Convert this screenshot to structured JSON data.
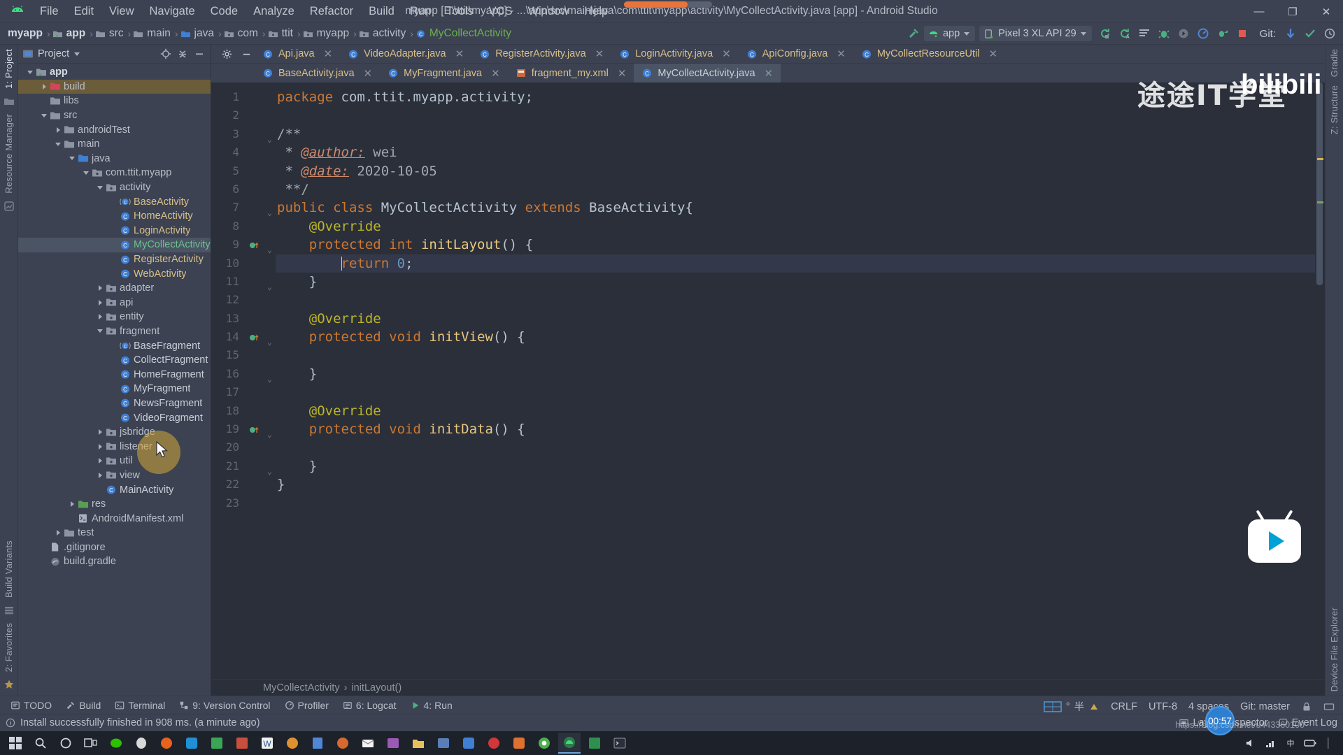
{
  "window": {
    "title": "myapp [E:\\ttit\\myapp] - ...\\app\\src\\main\\java\\com\\ttit\\myapp\\activity\\MyCollectActivity.java [app] - Android Studio",
    "minimize_label": "—",
    "maximize_label": "❐",
    "close_label": "✕"
  },
  "menu": [
    {
      "label": "File"
    },
    {
      "label": "Edit"
    },
    {
      "label": "View"
    },
    {
      "label": "Navigate"
    },
    {
      "label": "Code"
    },
    {
      "label": "Analyze"
    },
    {
      "label": "Refactor"
    },
    {
      "label": "Build"
    },
    {
      "label": "Run"
    },
    {
      "label": "Tools"
    },
    {
      "label": "VCS"
    },
    {
      "label": "Window"
    },
    {
      "label": "Help"
    }
  ],
  "breadcrumbs": [
    {
      "label": "myapp",
      "kind": "project"
    },
    {
      "label": "app",
      "kind": "module"
    },
    {
      "label": "src",
      "kind": "folder"
    },
    {
      "label": "main",
      "kind": "folder"
    },
    {
      "label": "java",
      "kind": "source-folder"
    },
    {
      "label": "com",
      "kind": "package"
    },
    {
      "label": "ttit",
      "kind": "package"
    },
    {
      "label": "myapp",
      "kind": "package"
    },
    {
      "label": "activity",
      "kind": "package"
    },
    {
      "label": "MyCollectActivity",
      "kind": "class"
    }
  ],
  "toolbar": {
    "module_selector": "app",
    "device_selector": "Pixel 3 XL API 29",
    "git_label": "Git:",
    "icons": [
      {
        "name": "sync-project-icon"
      },
      {
        "name": "avd-manager-icon"
      },
      {
        "name": "sdk-manager-icon"
      },
      {
        "name": "run-icon"
      },
      {
        "name": "debug-icon"
      },
      {
        "name": "run-coverage-icon"
      },
      {
        "name": "profiler-icon"
      },
      {
        "name": "attach-debugger-icon"
      },
      {
        "name": "stop-icon"
      },
      {
        "name": "update-project-icon"
      },
      {
        "name": "commit-icon"
      },
      {
        "name": "history-icon"
      }
    ]
  },
  "left_strip": [
    {
      "label": "1: Project",
      "active": true
    },
    {
      "label": "Resource Manager",
      "active": false
    },
    {
      "label": "Build Variants",
      "active": false
    },
    {
      "label": "2: Favorites",
      "active": false
    }
  ],
  "right_strip": [
    {
      "label": "Gradle"
    },
    {
      "label": "Z: Structure"
    },
    {
      "label": "Device File Explorer"
    }
  ],
  "project_panel": {
    "title": "Project",
    "tree": [
      {
        "depth": 0,
        "label": "app",
        "toggle": "open",
        "icon": "module-icon",
        "style": "bold"
      },
      {
        "depth": 1,
        "label": "build",
        "toggle": "closed",
        "icon": "folder-red-icon",
        "style": "plain",
        "selected_secondary": true
      },
      {
        "depth": 1,
        "label": "libs",
        "toggle": "none",
        "icon": "folder-icon",
        "style": "plain"
      },
      {
        "depth": 1,
        "label": "src",
        "toggle": "open",
        "icon": "folder-icon",
        "style": "plain"
      },
      {
        "depth": 2,
        "label": "androidTest",
        "toggle": "closed",
        "icon": "folder-icon",
        "style": "plain"
      },
      {
        "depth": 2,
        "label": "main",
        "toggle": "open",
        "icon": "folder-icon",
        "style": "plain"
      },
      {
        "depth": 3,
        "label": "java",
        "toggle": "open",
        "icon": "folder-blue-icon",
        "style": "plain"
      },
      {
        "depth": 4,
        "label": "com.ttit.myapp",
        "toggle": "open",
        "icon": "package-icon",
        "style": "plain"
      },
      {
        "depth": 5,
        "label": "activity",
        "toggle": "open",
        "icon": "package-icon",
        "style": "plain"
      },
      {
        "depth": 6,
        "label": "BaseActivity",
        "toggle": "none",
        "icon": "class-abstract-icon",
        "style": "java"
      },
      {
        "depth": 6,
        "label": "HomeActivity",
        "toggle": "none",
        "icon": "class-icon",
        "style": "java"
      },
      {
        "depth": 6,
        "label": "LoginActivity",
        "toggle": "none",
        "icon": "class-icon",
        "style": "java"
      },
      {
        "depth": 6,
        "label": "MyCollectActivity",
        "toggle": "none",
        "icon": "class-icon",
        "style": "green",
        "selected": true
      },
      {
        "depth": 6,
        "label": "RegisterActivity",
        "toggle": "none",
        "icon": "class-icon",
        "style": "java"
      },
      {
        "depth": 6,
        "label": "WebActivity",
        "toggle": "none",
        "icon": "class-icon",
        "style": "java"
      },
      {
        "depth": 5,
        "label": "adapter",
        "toggle": "closed",
        "icon": "package-icon",
        "style": "plain"
      },
      {
        "depth": 5,
        "label": "api",
        "toggle": "closed",
        "icon": "package-icon",
        "style": "plain"
      },
      {
        "depth": 5,
        "label": "entity",
        "toggle": "closed",
        "icon": "package-icon",
        "style": "plain"
      },
      {
        "depth": 5,
        "label": "fragment",
        "toggle": "open",
        "icon": "package-icon",
        "style": "plain"
      },
      {
        "depth": 6,
        "label": "BaseFragment",
        "toggle": "none",
        "icon": "class-abstract-icon",
        "style": "white"
      },
      {
        "depth": 6,
        "label": "CollectFragment",
        "toggle": "none",
        "icon": "class-icon",
        "style": "white"
      },
      {
        "depth": 6,
        "label": "HomeFragment",
        "toggle": "none",
        "icon": "class-icon",
        "style": "white"
      },
      {
        "depth": 6,
        "label": "MyFragment",
        "toggle": "none",
        "icon": "class-icon",
        "style": "white"
      },
      {
        "depth": 6,
        "label": "NewsFragment",
        "toggle": "none",
        "icon": "class-icon",
        "style": "white"
      },
      {
        "depth": 6,
        "label": "VideoFragment",
        "toggle": "none",
        "icon": "class-icon",
        "style": "white"
      },
      {
        "depth": 5,
        "label": "jsbridge",
        "toggle": "closed",
        "icon": "package-icon",
        "style": "plain"
      },
      {
        "depth": 5,
        "label": "listener",
        "toggle": "closed",
        "icon": "package-icon",
        "style": "plain"
      },
      {
        "depth": 5,
        "label": "util",
        "toggle": "closed",
        "icon": "package-icon",
        "style": "plain"
      },
      {
        "depth": 5,
        "label": "view",
        "toggle": "closed",
        "icon": "package-icon",
        "style": "plain"
      },
      {
        "depth": 5,
        "label": "MainActivity",
        "toggle": "none",
        "icon": "class-icon",
        "style": "white"
      },
      {
        "depth": 3,
        "label": "res",
        "toggle": "closed",
        "icon": "folder-green-icon",
        "style": "plain"
      },
      {
        "depth": 3,
        "label": "AndroidManifest.xml",
        "toggle": "none",
        "icon": "manifest-icon",
        "style": "plain"
      },
      {
        "depth": 2,
        "label": "test",
        "toggle": "closed",
        "icon": "folder-icon",
        "style": "plain"
      },
      {
        "depth": 1,
        "label": ".gitignore",
        "toggle": "none",
        "icon": "file-icon",
        "style": "plain"
      },
      {
        "depth": 1,
        "label": "build.gradle",
        "toggle": "none",
        "icon": "gradle-icon",
        "style": "plain"
      }
    ]
  },
  "editor": {
    "tabs_row1": [
      {
        "label": "Api.java",
        "icon": "class-icon",
        "active": false,
        "closable": true
      },
      {
        "label": "VideoAdapter.java",
        "icon": "class-icon",
        "active": false,
        "closable": true
      },
      {
        "label": "RegisterActivity.java",
        "icon": "class-icon",
        "active": false,
        "closable": true
      },
      {
        "label": "LoginActivity.java",
        "icon": "class-icon",
        "active": false,
        "closable": true
      },
      {
        "label": "ApiConfig.java",
        "icon": "class-icon",
        "active": false,
        "closable": true
      },
      {
        "label": "MyCollectResourceUtil",
        "icon": "class-icon",
        "active": false,
        "closable": true
      }
    ],
    "tabs_row2": [
      {
        "label": "BaseActivity.java",
        "icon": "class-icon",
        "active": false,
        "closable": true
      },
      {
        "label": "MyFragment.java",
        "icon": "class-icon",
        "active": false,
        "closable": true
      },
      {
        "label": "fragment_my.xml",
        "icon": "layout-icon",
        "active": false,
        "closable": true
      },
      {
        "label": "MyCollectActivity.java",
        "icon": "class-icon",
        "active": true,
        "closable": true
      }
    ],
    "line_numbers": [
      "1",
      "2",
      "3",
      "4",
      "5",
      "6",
      "7",
      "8",
      "9",
      "10",
      "11",
      "12",
      "13",
      "14",
      "15",
      "16",
      "17",
      "18",
      "19",
      "20",
      "21",
      "22",
      "23"
    ],
    "code_lines": [
      {
        "n": 1,
        "segments": [
          {
            "t": "package",
            "c": "kw"
          },
          {
            "t": " com.ttit.myapp.activity;",
            "c": "pl"
          }
        ]
      },
      {
        "n": 2,
        "segments": []
      },
      {
        "n": 3,
        "segments": [
          {
            "t": "/**",
            "c": "cmt"
          }
        ]
      },
      {
        "n": 4,
        "segments": [
          {
            "t": " * ",
            "c": "cmt"
          },
          {
            "t": "@author:",
            "c": "tagdoc"
          },
          {
            "t": " wei",
            "c": "cmt"
          }
        ]
      },
      {
        "n": 5,
        "segments": [
          {
            "t": " * ",
            "c": "cmt"
          },
          {
            "t": "@date:",
            "c": "tagdoc"
          },
          {
            "t": " 2020-10-05",
            "c": "cmt"
          }
        ]
      },
      {
        "n": 6,
        "segments": [
          {
            "t": " **/",
            "c": "cmt"
          }
        ]
      },
      {
        "n": 7,
        "segments": [
          {
            "t": "public class",
            "c": "kw"
          },
          {
            "t": " MyCollectActivity ",
            "c": "pl"
          },
          {
            "t": "extends",
            "c": "kw"
          },
          {
            "t": " BaseActivity{",
            "c": "pl"
          }
        ]
      },
      {
        "n": 8,
        "segments": [
          {
            "t": "    ",
            "c": "pl"
          },
          {
            "t": "@Override",
            "c": "anno"
          }
        ]
      },
      {
        "n": 9,
        "segments": [
          {
            "t": "    ",
            "c": "pl"
          },
          {
            "t": "protected int",
            "c": "kw"
          },
          {
            "t": " ",
            "c": "pl"
          },
          {
            "t": "initLayout",
            "c": "fn"
          },
          {
            "t": "() {",
            "c": "pl"
          }
        ]
      },
      {
        "n": 10,
        "segments": [
          {
            "t": "        ",
            "c": "pl"
          },
          {
            "t": "return",
            "c": "kw"
          },
          {
            "t": " ",
            "c": "pl"
          },
          {
            "t": "0",
            "c": "num"
          },
          {
            "t": ";",
            "c": "pl"
          }
        ],
        "highlight": true,
        "bulb": true
      },
      {
        "n": 11,
        "segments": [
          {
            "t": "    }",
            "c": "pl"
          }
        ]
      },
      {
        "n": 12,
        "segments": []
      },
      {
        "n": 13,
        "segments": [
          {
            "t": "    ",
            "c": "pl"
          },
          {
            "t": "@Override",
            "c": "anno"
          }
        ]
      },
      {
        "n": 14,
        "segments": [
          {
            "t": "    ",
            "c": "pl"
          },
          {
            "t": "protected void",
            "c": "kw"
          },
          {
            "t": " ",
            "c": "pl"
          },
          {
            "t": "initView",
            "c": "fn"
          },
          {
            "t": "() {",
            "c": "pl"
          }
        ]
      },
      {
        "n": 15,
        "segments": []
      },
      {
        "n": 16,
        "segments": [
          {
            "t": "    }",
            "c": "pl"
          }
        ]
      },
      {
        "n": 17,
        "segments": []
      },
      {
        "n": 18,
        "segments": [
          {
            "t": "    ",
            "c": "pl"
          },
          {
            "t": "@Override",
            "c": "anno"
          }
        ]
      },
      {
        "n": 19,
        "segments": [
          {
            "t": "    ",
            "c": "pl"
          },
          {
            "t": "protected void",
            "c": "kw"
          },
          {
            "t": " ",
            "c": "pl"
          },
          {
            "t": "initData",
            "c": "fn"
          },
          {
            "t": "() {",
            "c": "pl"
          }
        ]
      },
      {
        "n": 20,
        "segments": []
      },
      {
        "n": 21,
        "segments": [
          {
            "t": "    }",
            "c": "pl"
          }
        ]
      },
      {
        "n": 22,
        "segments": [
          {
            "t": "}",
            "c": "pl"
          }
        ]
      },
      {
        "n": 23,
        "segments": []
      }
    ],
    "breadcrumb": [
      {
        "label": "MyCollectActivity"
      },
      {
        "label": "initLayout()"
      }
    ]
  },
  "bottom_tools": [
    {
      "label": "TODO",
      "icon": "todo-icon"
    },
    {
      "label": "Build",
      "icon": "build-icon"
    },
    {
      "label": "Terminal",
      "icon": "terminal-icon"
    },
    {
      "label": "9: Version Control",
      "icon": "vcs-icon"
    },
    {
      "label": "Profiler",
      "icon": "profiler-icon"
    },
    {
      "label": "6: Logcat",
      "icon": "logcat-icon"
    },
    {
      "label": "4: Run",
      "icon": "run-icon"
    }
  ],
  "status": {
    "message": "Install successfully finished in 908 ms. (a minute ago)",
    "layout_inspector": "Layout Inspector",
    "event_log": "Event Log",
    "line_sep": "CRLF",
    "encoding": "UTF-8",
    "indent": "4 spaces",
    "git_branch": "Git: master",
    "degree": "°"
  },
  "overlays": {
    "watermark": "途途IT学堂",
    "bilibili": "bilibili",
    "timer": "00:57",
    "url_hint": "https://blog.csdn.net/u443360100"
  },
  "taskbar": {
    "items": [
      {
        "name": "start-button"
      },
      {
        "name": "search-icon"
      },
      {
        "name": "cortana-icon"
      },
      {
        "name": "task-view-icon"
      },
      {
        "name": "app-wechat"
      },
      {
        "name": "app-qq"
      },
      {
        "name": "app-firefox"
      },
      {
        "name": "app-tim"
      },
      {
        "name": "app-editor"
      },
      {
        "name": "app-store"
      },
      {
        "name": "app-word"
      },
      {
        "name": "app-browser"
      },
      {
        "name": "app-notes"
      },
      {
        "name": "app-explorer"
      },
      {
        "name": "app-mail"
      },
      {
        "name": "app-media"
      },
      {
        "name": "app-folder"
      },
      {
        "name": "app-capture"
      },
      {
        "name": "app-other1"
      },
      {
        "name": "app-music"
      },
      {
        "name": "app-video"
      },
      {
        "name": "app-chrome"
      },
      {
        "name": "app-androidstudio"
      },
      {
        "name": "app-sheet"
      },
      {
        "name": "app-terminal"
      }
    ],
    "clock_time": "",
    "tray": [
      {
        "name": "tray-volume-icon"
      },
      {
        "name": "tray-network-icon"
      },
      {
        "name": "tray-battery-icon"
      },
      {
        "name": "tray-ime-icon"
      }
    ]
  },
  "colors": {
    "accent_green": "#499c54",
    "chrome_bg": "#3c4252",
    "editor_bg": "#2b2f3a",
    "selection": "#4b5465",
    "keyword": "#cc7832",
    "string": "#6a8759",
    "number": "#6897bb",
    "annotation": "#bbb529",
    "java_file": "#d7c08a",
    "progress": "#e8743b"
  }
}
